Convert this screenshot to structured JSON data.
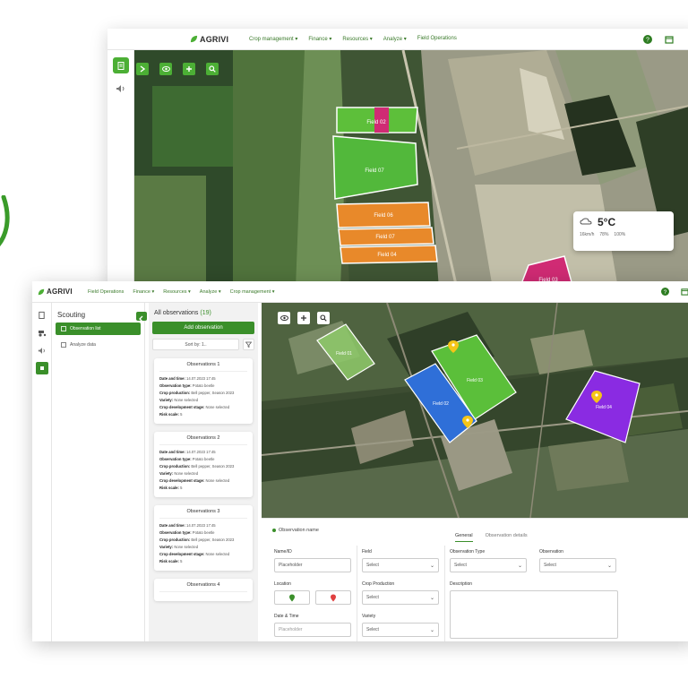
{
  "back_window": {
    "logo": "AGRIVI",
    "nav": [
      "Crop management ▾",
      "Finance ▾",
      "Resources ▾",
      "Analyze ▾",
      "Field Operations"
    ],
    "fields": [
      {
        "label": "Field 02",
        "color": "#5dbf3a"
      },
      {
        "label": "Field 07",
        "color": "#52b83b"
      },
      {
        "label": "Field 06",
        "color": "#e8892a"
      },
      {
        "label": "Field 07",
        "color": "#e8892a"
      },
      {
        "label": "Field 04",
        "color": "#e8892a"
      },
      {
        "label": "Field 03",
        "color": "#d02b74"
      }
    ],
    "weather": {
      "temp": "5°C",
      "wind": "16km/h",
      "clouds": "78%",
      "humidity": "100%"
    }
  },
  "front_window": {
    "logo": "AGRIVI",
    "nav": [
      "Field Operations",
      "Finance ▾",
      "Resources ▾",
      "Analyze ▾",
      "Crop management ▾"
    ],
    "scouting": {
      "title": "Scouting",
      "items": [
        {
          "label": "Observation list",
          "active": true
        },
        {
          "label": "Analyze data",
          "active": false
        }
      ]
    },
    "observations": {
      "heading": "All observations",
      "count": "(19)",
      "add_label": "Add observation",
      "sort_label": "Sort by: 1..",
      "cards": [
        {
          "title": "Observations 1",
          "date_label": "Date and time:",
          "date": "14.07.2023 17:45",
          "type_label": "Observation type:",
          "type": "Potato beetle",
          "crop_label": "Crop production:",
          "crop": "Bell pepper, Season 2023",
          "variety_label": "Variety:",
          "variety": "None selected",
          "stage_label": "Crop development stage:",
          "stage": "None selected",
          "risk_label": "Risk scale:",
          "risk": "5"
        },
        {
          "title": "Observations 2",
          "date_label": "Date and time:",
          "date": "14.07.2023 17:45",
          "type_label": "Observation type:",
          "type": "Potato beetle",
          "crop_label": "Crop production:",
          "crop": "Bell pepper, Season 2023",
          "variety_label": "Variety:",
          "variety": "None selected",
          "stage_label": "Crop development stage:",
          "stage": "None selected",
          "risk_label": "Risk scale:",
          "risk": "5"
        },
        {
          "title": "Observations 3",
          "date_label": "Date and time:",
          "date": "14.07.2023 17:45",
          "type_label": "Observation type:",
          "type": "Potato beetle",
          "crop_label": "Crop production:",
          "crop": "Bell pepper, Season 2023",
          "variety_label": "Variety:",
          "variety": "None selected",
          "stage_label": "Crop development stage:",
          "stage": "None selected",
          "risk_label": "Risk scale:",
          "risk": "5"
        },
        {
          "title": "Observations 4"
        }
      ]
    },
    "map_fields": [
      {
        "label": "Field 01",
        "color": "#8ec96a"
      },
      {
        "label": "Field 03",
        "color": "#5bbf3a"
      },
      {
        "label": "Field 02",
        "color": "#2f6fd8"
      },
      {
        "label": "Field 04",
        "color": "#8a2be2"
      }
    ],
    "form": {
      "title": "Observation name",
      "tabs": [
        "General",
        "Observation details"
      ],
      "name_label": "Name/ID",
      "name_placeholder": "Placeholder",
      "field_label": "Field",
      "field_value": "Select",
      "obs_type_label": "Observation Type",
      "obs_type_value": "Select",
      "observation_label": "Observation",
      "observation_value": "Select",
      "location_label": "Location",
      "crop_prod_label": "Crop Production",
      "crop_prod_value": "Select",
      "description_label": "Description",
      "date_label": "Date & Time",
      "date_placeholder": "Placeholder",
      "variety_label": "Variety",
      "variety_value": "Select"
    }
  },
  "colors": {
    "accent": "#3a8f2a",
    "brand": "#4caf35"
  }
}
